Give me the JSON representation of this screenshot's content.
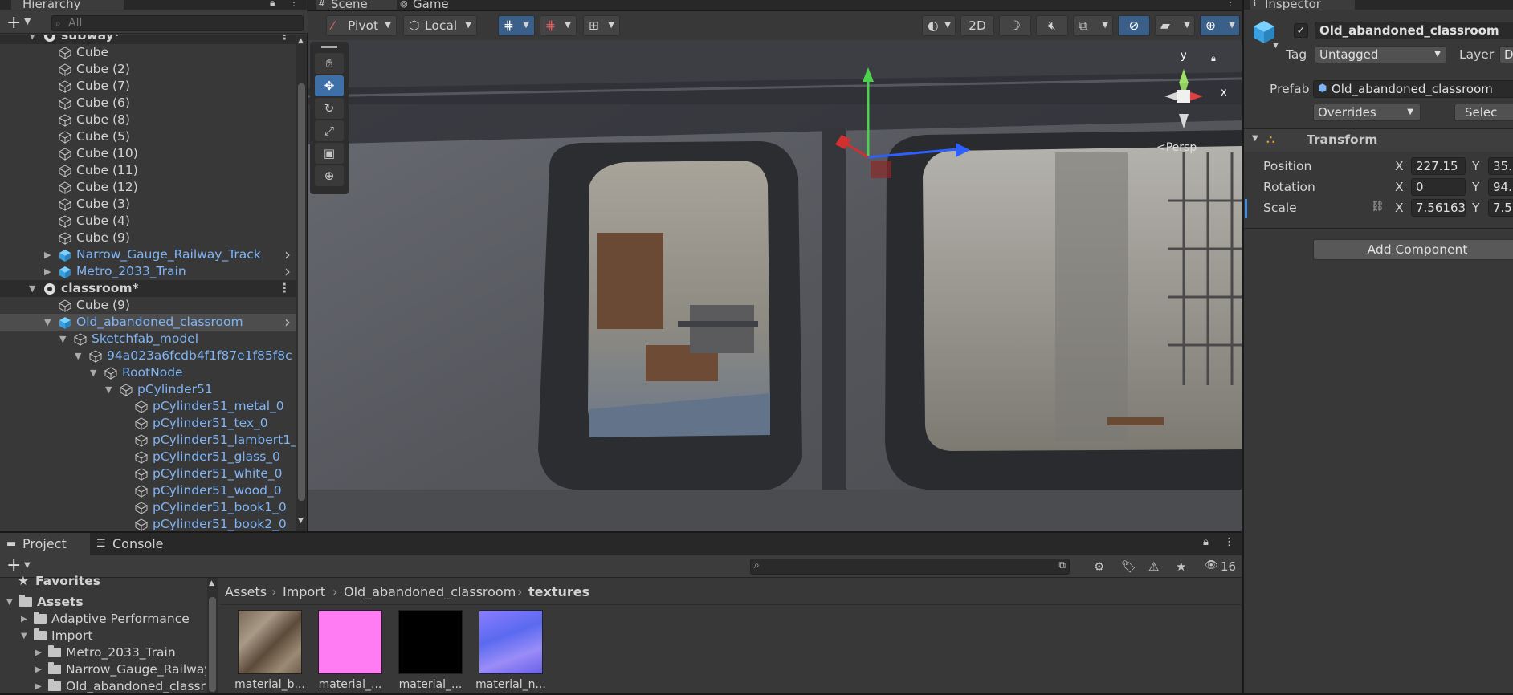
{
  "hierarchy": {
    "tab": "Hierarchy",
    "search_placeholder": "All",
    "rows": [
      {
        "label": "Cube",
        "indent": 3,
        "type": "cube",
        "partial": true
      },
      {
        "label": "Cube (2)",
        "indent": 3,
        "type": "cube"
      },
      {
        "label": "Cube (7)",
        "indent": 3,
        "type": "cube"
      },
      {
        "label": "Cube (6)",
        "indent": 3,
        "type": "cube"
      },
      {
        "label": "Cube (8)",
        "indent": 3,
        "type": "cube"
      },
      {
        "label": "Cube (5)",
        "indent": 3,
        "type": "cube"
      },
      {
        "label": "Cube (10)",
        "indent": 3,
        "type": "cube"
      },
      {
        "label": "Cube (11)",
        "indent": 3,
        "type": "cube"
      },
      {
        "label": "Cube (12)",
        "indent": 3,
        "type": "cube"
      },
      {
        "label": "Cube (3)",
        "indent": 3,
        "type": "cube"
      },
      {
        "label": "Cube (4)",
        "indent": 3,
        "type": "cube"
      },
      {
        "label": "Cube (9)",
        "indent": 3,
        "type": "cube"
      },
      {
        "label": "Narrow_Gauge_Railway_Track",
        "indent": 3,
        "type": "prefab",
        "collapsed": true,
        "arrow": true
      },
      {
        "label": "Metro_2033_Train",
        "indent": 3,
        "type": "prefab",
        "collapsed": true,
        "arrow": true
      },
      {
        "label": "classroom*",
        "indent": 2,
        "type": "scene",
        "expanded": true
      },
      {
        "label": "Cube (9)",
        "indent": 3,
        "type": "cube"
      },
      {
        "label": "Old_abandoned_classroom",
        "indent": 3,
        "type": "prefab",
        "expanded": true,
        "arrow": true,
        "selected": true
      },
      {
        "label": "Sketchfab_model",
        "indent": 4,
        "type": "cube-blue",
        "expanded": true
      },
      {
        "label": "94a023a6fcdb4f1f87e1f85f8c",
        "indent": 5,
        "type": "cube-blue",
        "expanded": true
      },
      {
        "label": "RootNode",
        "indent": 6,
        "type": "cube-blue",
        "expanded": true
      },
      {
        "label": "pCylinder51",
        "indent": 7,
        "type": "cube-blue",
        "expanded": true
      },
      {
        "label": "pCylinder51_metal_0",
        "indent": 8,
        "type": "cube-blue"
      },
      {
        "label": "pCylinder51_tex_0",
        "indent": 8,
        "type": "cube-blue"
      },
      {
        "label": "pCylinder51_lambert1_",
        "indent": 8,
        "type": "cube-blue"
      },
      {
        "label": "pCylinder51_glass_0",
        "indent": 8,
        "type": "cube-blue"
      },
      {
        "label": "pCylinder51_white_0",
        "indent": 8,
        "type": "cube-blue"
      },
      {
        "label": "pCylinder51_wood_0",
        "indent": 8,
        "type": "cube-blue"
      },
      {
        "label": "pCylinder51_book1_0",
        "indent": 8,
        "type": "cube-blue"
      },
      {
        "label": "pCylinder51_book2_0",
        "indent": 8,
        "type": "cube-blue"
      }
    ],
    "scene_row": {
      "label": "subway*"
    }
  },
  "scene": {
    "tabs": [
      "Scene",
      "Game"
    ],
    "pivot_label": "Pivot",
    "local_label": "Local",
    "mode_2d": "2D",
    "persp_label": "<Persp",
    "axis_y": "y",
    "axis_x": "x"
  },
  "inspector": {
    "tab": "Inspector",
    "object_name": "Old_abandoned_classroom",
    "tag_label": "Tag",
    "tag_value": "Untagged",
    "layer_label": "Layer",
    "layer_value": "D",
    "prefab_label": "Prefab",
    "prefab_value": "Old_abandoned_classroom",
    "overrides_label": "Overrides",
    "select_label": "Selec",
    "transform_label": "Transform",
    "position_label": "Position",
    "rotation_label": "Rotation",
    "scale_label": "Scale",
    "x": "X",
    "y": "Y",
    "position_x": "227.15",
    "position_y": "35.",
    "rotation_x": "0",
    "rotation_y": "94.",
    "scale_x": "7.56163",
    "scale_y": "7.5",
    "add_component": "Add Component"
  },
  "project": {
    "tabs": [
      "Project",
      "Console"
    ],
    "hidden_count": "16",
    "favorites": "Favorites",
    "tree": [
      {
        "label": "Assets",
        "indent": 0,
        "bold": true
      },
      {
        "label": "Adaptive Performance",
        "indent": 1
      },
      {
        "label": "Import",
        "indent": 1
      },
      {
        "label": "Metro_2033_Train",
        "indent": 2
      },
      {
        "label": "Narrow_Gauge_Railway",
        "indent": 2
      },
      {
        "label": "Old_abandoned_classr",
        "indent": 2,
        "partial": true
      }
    ],
    "breadcrumb": [
      "Assets",
      "Import",
      "Old_abandoned_classroom",
      "textures"
    ],
    "thumbnails": [
      {
        "label": "material_b...",
        "color": "#8a7a66"
      },
      {
        "label": "material_...",
        "color": "#ff7cf2"
      },
      {
        "label": "material_...",
        "color": "#000000"
      },
      {
        "label": "material_n...",
        "color": "#7a6cf0"
      }
    ]
  },
  "colors": {
    "panel": "#383838",
    "accent_blue": "#3e6fa6",
    "prefab_text": "#7fb4f5"
  }
}
